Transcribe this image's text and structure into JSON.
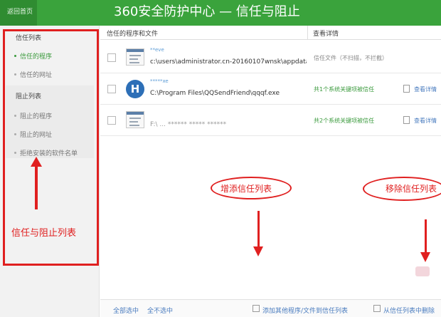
{
  "header": {
    "back_label": "返回首页",
    "title": "360安全防护中心 — 信任与阻止",
    "bg_color": "#3aa33c"
  },
  "sidebar": {
    "trust_section": "信任列表",
    "trust_items": [
      "信任的程序",
      "信任的网址"
    ],
    "block_section": "阻止列表",
    "block_items": [
      "阻止的程序",
      "阻止的网址",
      "拒绝安装的软件名单"
    ],
    "active_item": "信任的程序"
  },
  "table": {
    "col_file": "信任的程序和文件",
    "col_detail": "查看详情",
    "rows": [
      {
        "name": "**eve",
        "path": "c:\\users\\administrator.cn-20160107wnsk\\appdata",
        "detail": "信任文件（不扫描，不拦截）",
        "detail_color": "#888888",
        "icon": "file-window-icon",
        "view": ""
      },
      {
        "name": "*****xe",
        "path": "C:\\Program Files\\QQSendFriend\\qqqf.exe",
        "detail": "共1个系统关键项被信任",
        "detail_color": "#3a9a3c",
        "icon": "h-app-icon",
        "view": "查看详情"
      },
      {
        "name": "",
        "path": "F:\\ ... ****** ***** ******",
        "detail": "共2个系统关键项被信任",
        "detail_color": "#3a9a3c",
        "icon": "file-window-icon",
        "view": "查看详情"
      }
    ]
  },
  "annotations": {
    "left_label": "信任与阻止列表",
    "add_label": "增添信任列表",
    "remove_label": "移除信任列表"
  },
  "footer": {
    "select_all": "全部选中",
    "deselect_all": "全不选中",
    "add_file": "添加其他程序/文件到信任列表",
    "remove": "从信任列表中删除"
  }
}
